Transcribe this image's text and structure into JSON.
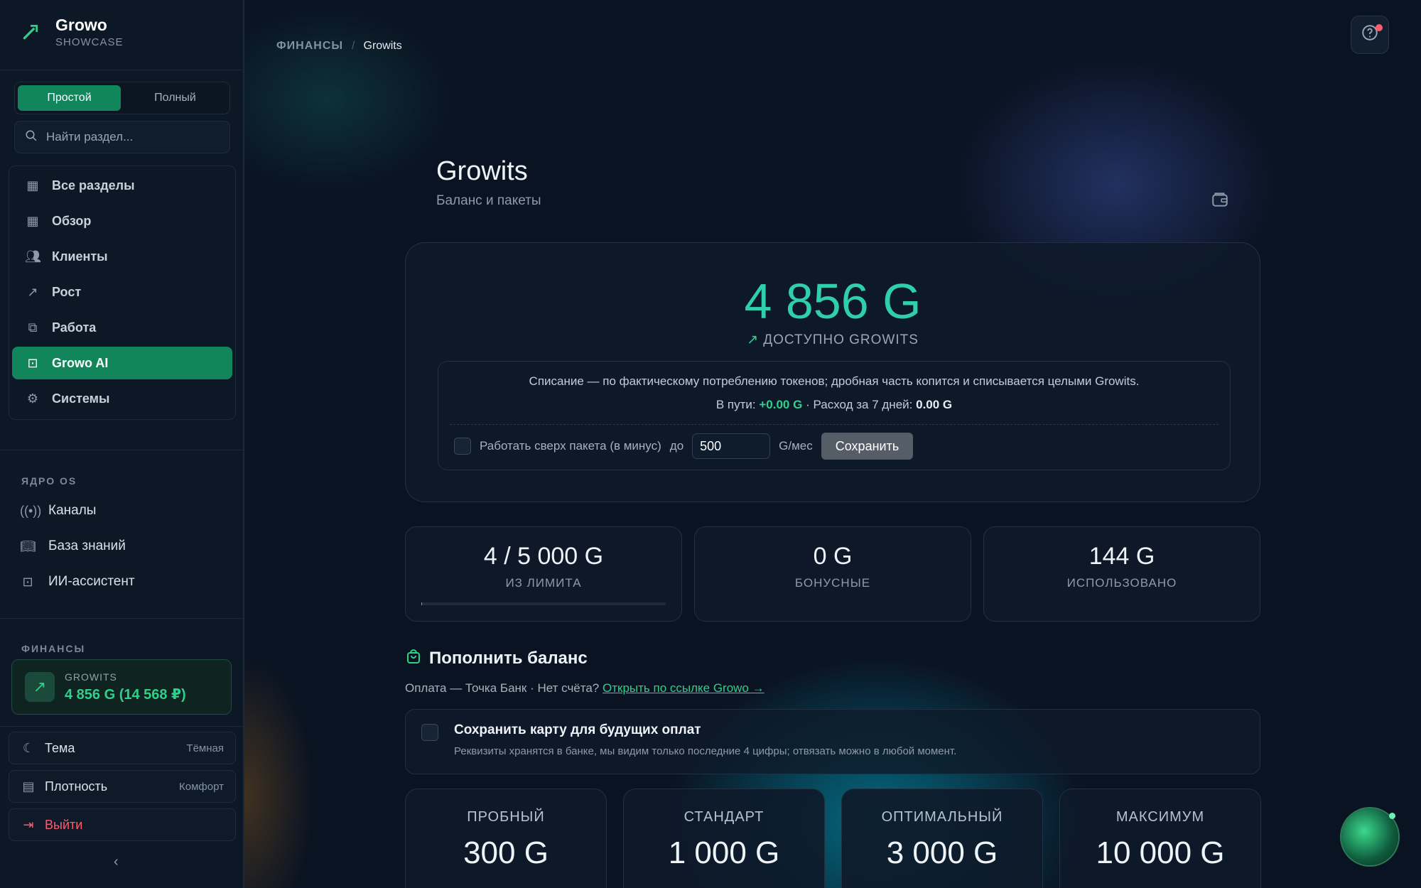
{
  "app": {
    "title": "Growo",
    "subtitle": "SHOWCASE"
  },
  "mode": {
    "simple": "Простой",
    "full": "Полный"
  },
  "search": {
    "placeholder": "Найти раздел..."
  },
  "nav": [
    {
      "label": "Все разделы",
      "icon": "grid-icon"
    },
    {
      "label": "Обзор",
      "icon": "dashboard-icon"
    },
    {
      "label": "Клиенты",
      "icon": "users-icon"
    },
    {
      "label": "Рост",
      "icon": "trend-icon"
    },
    {
      "label": "Работа",
      "icon": "workflow-icon"
    },
    {
      "label": "Growo AI",
      "icon": "robot-icon",
      "active": true
    },
    {
      "label": "Системы",
      "icon": "gear-icon"
    }
  ],
  "core": {
    "title": "ЯДРО OS",
    "items": [
      "Каналы",
      "База знаний",
      "ИИ-ассистент"
    ]
  },
  "finance": {
    "title": "ФИНАНСЫ",
    "label": "GROWITS",
    "value": "4 856 G (14 568 ₽)"
  },
  "settings": {
    "theme_label": "Тема",
    "theme_value": "Тёмная",
    "density_label": "Плотность",
    "density_value": "Комфорт",
    "logout": "Выйти"
  },
  "breadcrumb": {
    "section": "ФИНАНСЫ",
    "current": "Growits"
  },
  "page": {
    "title": "Growits",
    "subtitle": "Баланс и пакеты"
  },
  "balance": {
    "amount": "4 856 G",
    "label": "ДОСТУПНО GROWITS",
    "note": "Списание — по фактическому потреблению токенов; дробная часть копится и списывается целыми Growits.",
    "transit_label": "В пути:",
    "transit_value": "+0.00 G",
    "sep": "·",
    "spend_label": "Расход за 7 дней:",
    "spend_value": "0.00 G",
    "overdraft_label": "Работать сверх пакета (в минус)",
    "upto": "до",
    "limit_value": "500",
    "unit": "G/мес",
    "save": "Сохранить"
  },
  "stats": [
    {
      "value": "4 / 5 000 G",
      "label": "ИЗ ЛИМИТА",
      "progress": 0.0008
    },
    {
      "value": "0 G",
      "label": "БОНУСНЫЕ"
    },
    {
      "value": "144 G",
      "label": "ИСПОЛЬЗОВАНО"
    }
  ],
  "topup": {
    "title": "Пополнить баланс",
    "payment": "Оплата — Точка Банк · Нет счёта?",
    "link": "Открыть по ссылке Growo →",
    "save_card_title": "Сохранить карту для будущих оплат",
    "save_card_desc": "Реквизиты хранятся в банке, мы видим только последние 4 цифры; отвязать можно в любой момент."
  },
  "packages": [
    {
      "name": "ПРОБНЫЙ",
      "value": "300 G"
    },
    {
      "name": "СТАНДАРТ",
      "value": "1 000 G"
    },
    {
      "name": "ОПТИМАЛЬНЫЙ",
      "value": "3 000 G"
    },
    {
      "name": "МАКСИМУМ",
      "value": "10 000 G"
    }
  ],
  "colors": {
    "accent": "#11855c",
    "green": "#2fd08a",
    "teal": "#2fcfaa",
    "danger": "#ff5a6e"
  }
}
